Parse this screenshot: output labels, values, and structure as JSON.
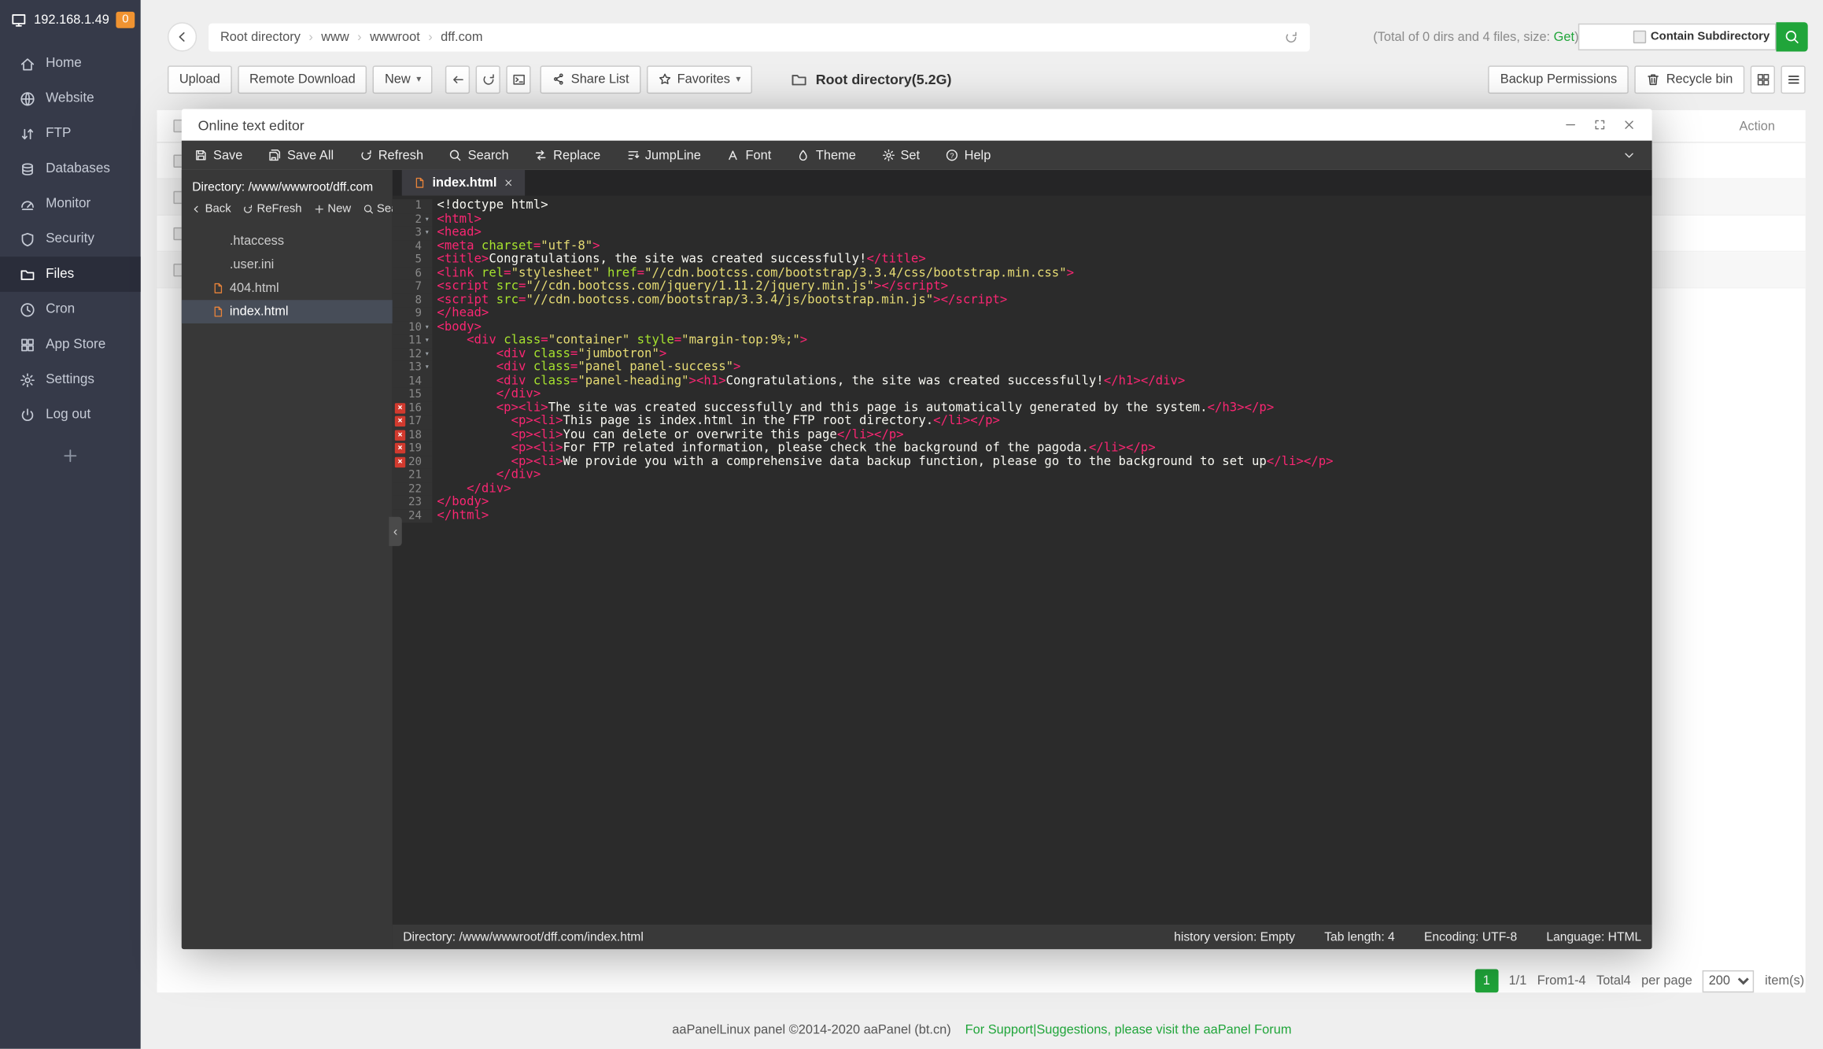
{
  "sidebar": {
    "server_ip": "192.168.1.49",
    "badge": "0",
    "items": [
      {
        "label": "Home",
        "icon": "home"
      },
      {
        "label": "Website",
        "icon": "globe"
      },
      {
        "label": "FTP",
        "icon": "transfer"
      },
      {
        "label": "Databases",
        "icon": "database"
      },
      {
        "label": "Monitor",
        "icon": "gauge"
      },
      {
        "label": "Security",
        "icon": "shield"
      },
      {
        "label": "Files",
        "icon": "folder",
        "active": true
      },
      {
        "label": "Cron",
        "icon": "clock"
      },
      {
        "label": "App Store",
        "icon": "grid"
      },
      {
        "label": "Settings",
        "icon": "gear"
      },
      {
        "label": "Log out",
        "icon": "power"
      }
    ]
  },
  "topbar": {
    "breadcrumbs": [
      "Root directory",
      "www",
      "wwwroot",
      "dff.com"
    ],
    "stats_prefix": "(Total of 0 dirs and 4 files, size: ",
    "stats_link": "Get",
    "stats_suffix": ")",
    "search_label": "Contain Subdirectory"
  },
  "toolbar": {
    "upload": "Upload",
    "remote_download": "Remote Download",
    "new": "New",
    "share_list": "Share List",
    "favorites": "Favorites",
    "current_dir": "Root directory(5.2G)",
    "backup_permissions": "Backup Permissions",
    "recycle_bin": "Recycle bin"
  },
  "file_table": {
    "action_header": "Action",
    "row_count": 4
  },
  "editor": {
    "title": "Online text editor",
    "menu": [
      {
        "label": "Save",
        "icon": "floppy"
      },
      {
        "label": "Save All",
        "icon": "floppy-all"
      },
      {
        "label": "Refresh",
        "icon": "refresh"
      },
      {
        "label": "Search",
        "icon": "search"
      },
      {
        "label": "Replace",
        "icon": "replace"
      },
      {
        "label": "JumpLine",
        "icon": "jumpline"
      },
      {
        "label": "Font",
        "icon": "font"
      },
      {
        "label": "Theme",
        "icon": "theme"
      },
      {
        "label": "Set",
        "icon": "gear"
      },
      {
        "label": "Help",
        "icon": "help"
      }
    ],
    "sidebar": {
      "directory_label": "Directory: /www/wwwroot/dff.com",
      "buttons": [
        {
          "label": "Back",
          "icon": "back"
        },
        {
          "label": "ReFresh",
          "icon": "refresh"
        },
        {
          "label": "New",
          "icon": "plus"
        },
        {
          "label": "Search",
          "icon": "search"
        }
      ],
      "files": [
        {
          "name": ".htaccess",
          "icon": false
        },
        {
          "name": ".user.ini",
          "icon": false
        },
        {
          "name": "404.html",
          "icon": true
        },
        {
          "name": "index.html",
          "icon": true,
          "selected": true
        }
      ]
    },
    "tab": {
      "name": "index.html"
    },
    "code": {
      "error_lines": [
        16,
        17,
        18,
        19,
        20
      ],
      "fold_lines": [
        2,
        3,
        10,
        11,
        12,
        13
      ],
      "lines": [
        "<!doctype html>",
        "<html>",
        "<head>",
        "<meta charset=\"utf-8\">",
        "<title>Congratulations, the site was created successfully!</title>",
        "<link rel=\"stylesheet\" href=\"//cdn.bootcss.com/bootstrap/3.3.4/css/bootstrap.min.css\">",
        "<script src=\"//cdn.bootcss.com/jquery/1.11.2/jquery.min.js\"></script>",
        "<script src=\"//cdn.bootcss.com/bootstrap/3.3.4/js/bootstrap.min.js\"></script>",
        "</head>",
        "<body>",
        "    <div class=\"container\" style=\"margin-top:9%;\">",
        "        <div class=\"jumbotron\">",
        "        <div class=\"panel panel-success\">",
        "        <div class=\"panel-heading\"><h1>Congratulations, the site was created successfully!</h1></div>",
        "        </div>",
        "        <p><li>The site was created successfully and this page is automatically generated by the system.</h3></p>",
        "          <p><li>This page is index.html in the FTP root directory.</li></p>",
        "          <p><li>You can delete or overwrite this page</li></p>",
        "          <p><li>For FTP related information, please check the background of the pagoda.</li></p>",
        "          <p><li>We provide you with a comprehensive data backup function, please go to the background to set up</li></p>",
        "        </div>",
        "    </div>",
        "</body>",
        "</html>"
      ]
    },
    "statusbar": {
      "left": "Directory: /www/wwwroot/dff.com/index.html",
      "history": "history version: Empty",
      "tab_length": "Tab length: 4",
      "encoding": "Encoding: UTF-8",
      "language": "Language: HTML"
    }
  },
  "pagination": {
    "page": "1",
    "page_indicator": "1/1",
    "range": "From1-4",
    "total": "Total4",
    "per_page_label": "per page",
    "per_page_value": "200",
    "items_label": "item(s)"
  },
  "footer": {
    "copyright": "aaPanelLinux panel ©2014-2020 aaPanel (bt.cn)",
    "support_link": "For Support|Suggestions, please visit the aaPanel Forum"
  }
}
